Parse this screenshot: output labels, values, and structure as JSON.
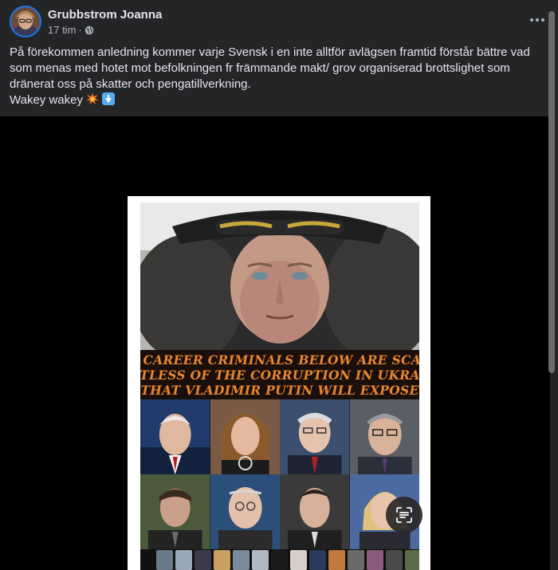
{
  "post": {
    "author": "Grubbstrom Joanna",
    "time": "17 tim",
    "separator": "·",
    "text_line1": "På förekommen anledning kommer varje Svensk i en inte alltför avlägsen framtid förstår bättre vad som menas med hotet mot befolkningen fr främmande makt/ grov organiserad brottslighet som dränerat oss på skatter och pengatillverkning.",
    "text_line2": "Wakey wakey",
    "more_icon": "more-horizontal-icon",
    "privacy_icon": "globe-icon"
  },
  "image": {
    "headline": [
      "The career criminals below are scared",
      "shitless of the corruption in Ukraine",
      "that Vladimir Putin will expose"
    ],
    "headline_color": "#e8862f",
    "lens_icon": "visual-search-icon"
  },
  "colors": {
    "background": "#242526",
    "media_background": "#000000",
    "text": "#e4e6eb",
    "secondary_text": "#b0b3b8"
  }
}
